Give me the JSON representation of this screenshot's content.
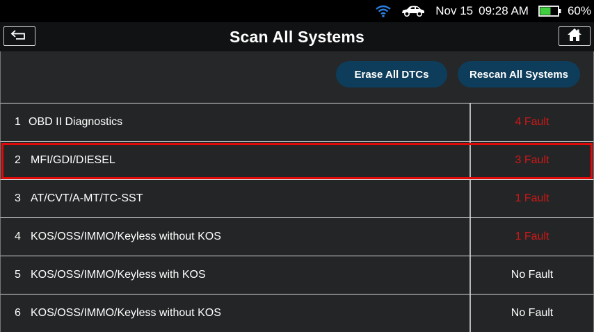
{
  "status_bar": {
    "date": "Nov 15",
    "time": "09:28 AM",
    "battery_percent": "60%",
    "battery_level": 0.6,
    "icons": [
      "wifi-icon",
      "car-icon",
      "battery-icon"
    ],
    "wifi_color": "#2b7de0",
    "battery_color": "#3fcf3f"
  },
  "header": {
    "title": "Scan All Systems",
    "back_icon": "back-arrow-icon",
    "home_icon": "home-icon"
  },
  "toolbar": {
    "erase_label": "Erase All DTCs",
    "rescan_label": "Rescan All Systems",
    "button_color": "#0e3d5b"
  },
  "systems": [
    {
      "num": "1",
      "name": "OBD II Diagnostics",
      "status": "4 Fault",
      "fault": true
    },
    {
      "num": "2",
      "name": "MFI/GDI/DIESEL",
      "status": "3 Fault",
      "fault": true,
      "selected": true
    },
    {
      "num": "3",
      "name": "AT/CVT/A-MT/TC-SST",
      "status": "1 Fault",
      "fault": true
    },
    {
      "num": "4",
      "name": "KOS/OSS/IMMO/Keyless without KOS",
      "status": "1 Fault",
      "fault": true
    },
    {
      "num": "5",
      "name": "KOS/OSS/IMMO/Keyless with KOS",
      "status": "No Fault",
      "fault": false
    },
    {
      "num": "6",
      "name": "KOS/OSS/IMMO/Keyless without KOS",
      "status": "No Fault",
      "fault": false
    }
  ],
  "colors": {
    "fault": "#d01818",
    "selection_border": "#e10a0a"
  }
}
